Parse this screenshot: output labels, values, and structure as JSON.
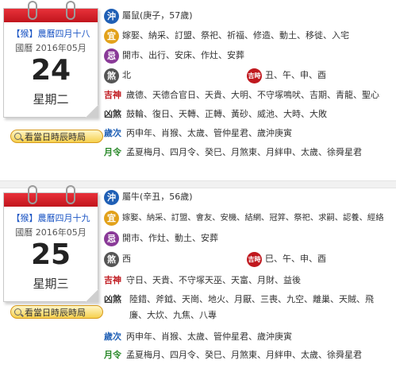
{
  "days": [
    {
      "lunar": "【猴】農曆四月十八",
      "gregorian": "國曆 2016年05月",
      "date": "24",
      "weekday": "星期二",
      "button": "看當日時辰時局",
      "chong_icon": "沖",
      "chong": "屬鼠(庚子，57歲)",
      "yi_icon": "宜",
      "yi": "嫁娶、納采、訂盟、祭祀、祈福、修造、動土、移徙、入宅",
      "ji_icon": "忌",
      "ji": "開市、出行、安床、作灶、安葬",
      "sha_icon": "煞",
      "sha": "北",
      "jishi_icon": "吉時",
      "jishi": "丑、午、申、酉",
      "jishen_label": "吉神",
      "jishen": "歲德、天德合官日、天貴、大明、不守塚鳴吠、吉期、青龍、聖心",
      "xiongsha_label": "凶煞",
      "xiongsha": "鼓輪、復日、天轉、正轉、黃砂、威池、大時、大敗",
      "suici_label": "歲次",
      "suici": "丙申年、肖猴、太歲、管仲星君、歲沖庚寅",
      "yueling_label": "月令",
      "yueling": "孟夏梅月、四月令、癸巳、月煞東、月絆申、太歲、徐舜星君"
    },
    {
      "lunar": "【猴】農曆四月十九",
      "gregorian": "國曆 2016年05月",
      "date": "25",
      "weekday": "星期三",
      "button": "看當日時辰時局",
      "chong_icon": "沖",
      "chong": "屬牛(辛丑，56歲)",
      "yi_icon": "宜",
      "yi": "嫁娶、納采、訂盟、會友、安機、結網、冠笄、祭祀、求嗣、認養、經絡",
      "ji_icon": "忌",
      "ji": "開市、作灶、動土、安葬",
      "sha_icon": "煞",
      "sha": "西",
      "jishi_icon": "吉時",
      "jishi": "巳、午、申、酉",
      "jishen_label": "吉神",
      "jishen": "守日、天貴、不守塚天巫、天富、月財、益後",
      "xiongsha_label": "凶煞",
      "xiongsha": "陸錯、斧鉞、天崗、地火、月厭、三喪、九空、離巢、天賊、飛廉、大炊、九焦、八專",
      "suici_label": "歲次",
      "suici": "丙申年、肖猴、太歲、管仲星君、歲沖庚寅",
      "yueling_label": "月令",
      "yueling": "孟夏梅月、四月令、癸巳、月煞東、月絆申、太歲、徐舜星君"
    }
  ]
}
